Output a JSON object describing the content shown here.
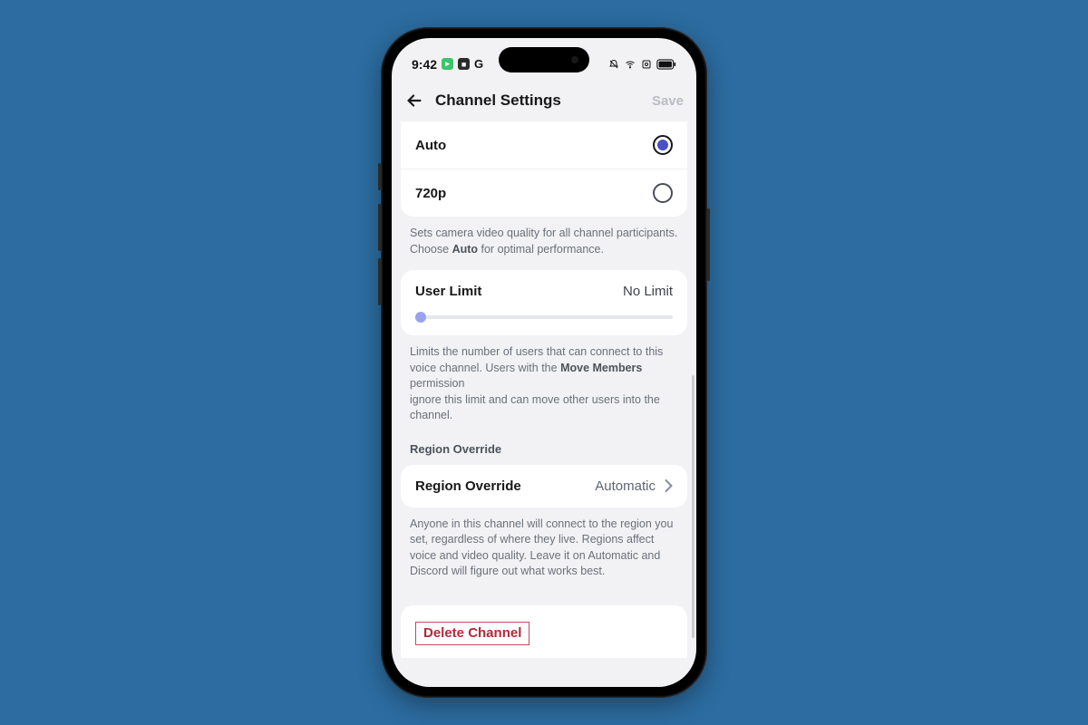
{
  "status": {
    "time": "9:42",
    "g_label": "G"
  },
  "header": {
    "title": "Channel Settings",
    "save_label": "Save"
  },
  "quality": {
    "options": [
      {
        "label": "Auto",
        "selected": true
      },
      {
        "label": "720p",
        "selected": false
      }
    ],
    "help_pre": "Sets camera video quality for all channel participants. Choose ",
    "help_bold": "Auto",
    "help_post": " for optimal performance."
  },
  "user_limit": {
    "label": "User Limit",
    "value": "No Limit",
    "help_pre": "Limits the number of users that can connect to this voice channel. Users with the ",
    "help_bold": "Move Members",
    "help_mid": " permission",
    "help_post": "ignore this limit and can move other users into the channel."
  },
  "region": {
    "section_title": "Region Override",
    "row_label": "Region Override",
    "row_value": "Automatic",
    "help": "Anyone in this channel will connect to the region you set, regardless of where they live. Regions affect voice and video quality. Leave it on Automatic and Discord will figure out what works best."
  },
  "delete": {
    "label": "Delete Channel"
  }
}
